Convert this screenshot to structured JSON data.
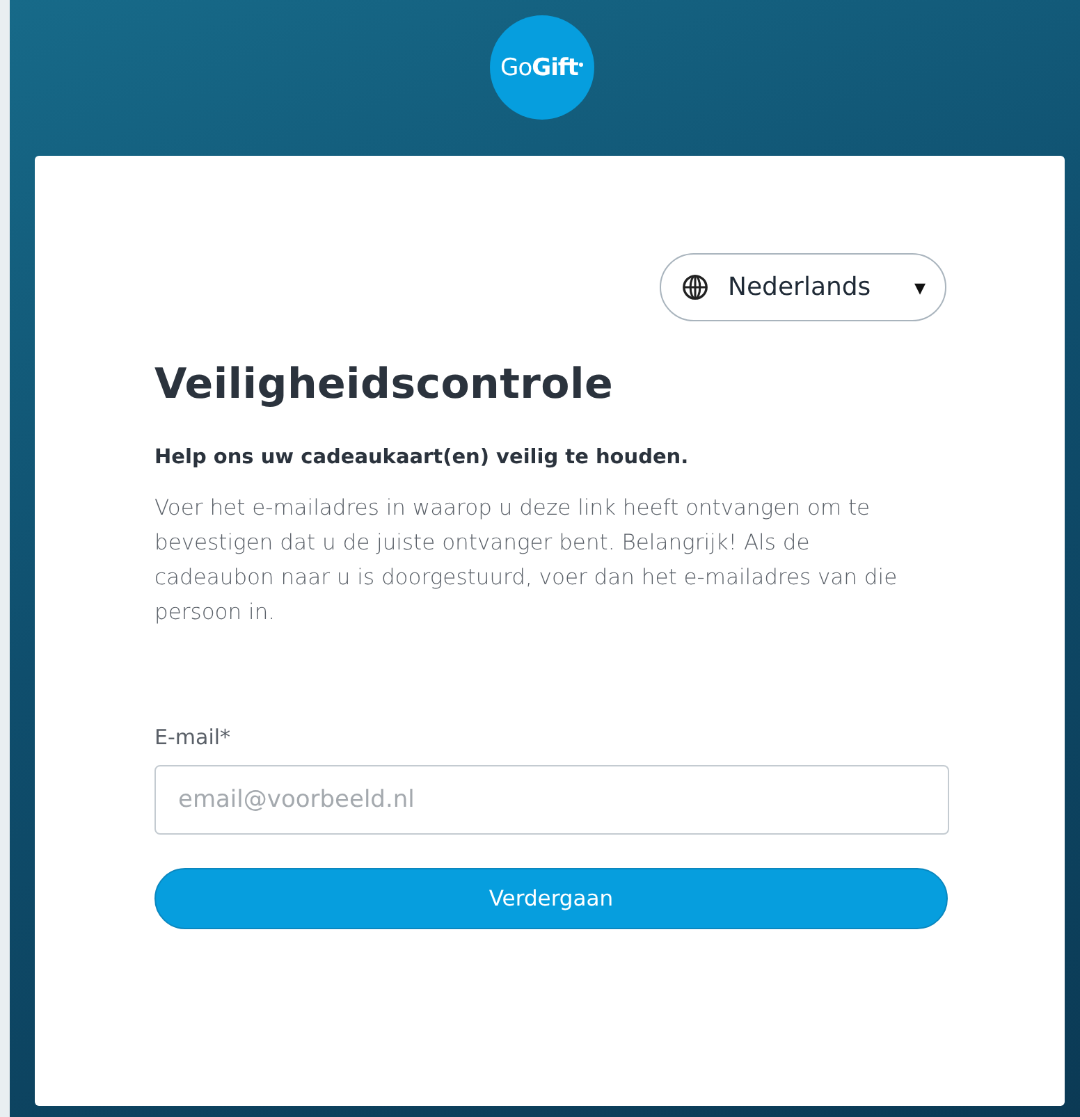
{
  "logo": {
    "text": "Go**Gift**"
  },
  "language_selector": {
    "label": "Nederlands",
    "caret": "▾"
  },
  "title": "Veiligheidscontrole",
  "subtitle": "Help ons uw cadeaukaart(en) veilig te houden.",
  "description": "Voer het e-mailadres in waarop u deze link heeft ontvangen om te bevestigen dat u de juiste ontvanger bent. Belangrijk! Als de cadeaubon naar u is doorgestuurd, voer dan het e-mailadres van die persoon in.",
  "email_field": {
    "label": "E-mail*",
    "placeholder": "email@voorbeeld.nl"
  },
  "submit_button": {
    "label": "Verdergaan"
  }
}
